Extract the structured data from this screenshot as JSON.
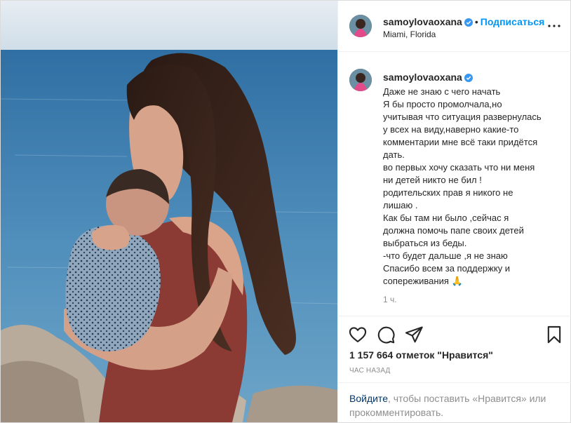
{
  "post": {
    "username": "samoylovaoxana",
    "location": "Miami, Florida",
    "follow_label": "Подписаться",
    "dot": "•",
    "caption_lines": [
      "Даже не знаю с чего начать",
      "Я бы просто промолчала,но",
      "учитывая что ситуация развернулась",
      "у всех на виду,наверно какие-то",
      "комментарии мне всё таки придётся",
      "дать.",
      "во первых хочу сказать что ни меня",
      "ни детей никто не бил !",
      "родительских прав я никого не",
      "лишаю .",
      "Как бы там ни было ,сейчас я",
      "должна помочь папе своих детей",
      "выбраться из беды.",
      "-что будет дальше ,я не знаю",
      "Спасибо всем за поддержку и",
      "сопереживания 🙏"
    ],
    "caption_time": "1 ч.",
    "likes_text": "1 157 664 отметок \"Нравится\"",
    "posted_ago": "ЧАС НАЗАД"
  },
  "login_prompt": {
    "link": "Войдите",
    "rest": ", чтобы поставить «Нравится» или прокомментировать."
  },
  "icons": {
    "like": "heart-icon",
    "comment": "comment-icon",
    "share": "send-icon",
    "save": "bookmark-icon",
    "more": "more-options-icon",
    "verified": "verified-badge-icon"
  },
  "colors": {
    "accent": "#0095f6",
    "link_dark": "#00376b",
    "text": "#262626",
    "muted": "#8e8e8e",
    "border": "#efefef"
  }
}
